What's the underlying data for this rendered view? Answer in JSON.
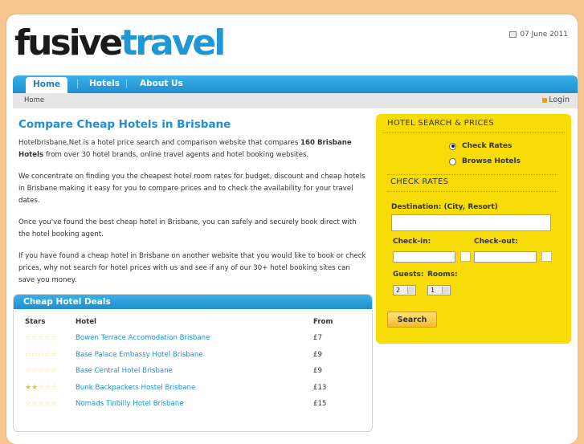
{
  "logo": {
    "part1": "fusive",
    "part2": "travel"
  },
  "date": "07 June 2011",
  "nav": {
    "home": "Home",
    "hotels": "Hotels",
    "about": "About Us"
  },
  "breadcrumb": {
    "home": "Home",
    "login": "Login"
  },
  "main": {
    "title": "Compare Cheap Hotels in Brisbane",
    "p1_a": "Hotelbrisbane.Net is a hotel price search and comparison website that compares ",
    "p1_bold": "160 Brisbane Hotels",
    "p1_b": " from over 30 hotel brands, online travel agents and hotel booking websites.",
    "p2": "We concentrate on finding you the cheapest hotel room rates for budget, discount and cheap hotels in Brisbane making it easy for you to compare prices and to check the availability for your travel dates.",
    "p3": "Once you've found the best cheap hotel in Brisbane, you can safely and securely book direct with the hotel booking agent.",
    "p4": "If you have found a cheap hotel in Brisbane on another website that you would like to book or check prices, why not search for hotel prices with us and see if any of our 30+ hotel booking sites can save you money."
  },
  "deals": {
    "title": "Cheap Hotel Deals",
    "headers": {
      "stars": "Stars",
      "hotel": "Hotel",
      "from": "From"
    },
    "rows": [
      {
        "stars": 0,
        "hotel": "Bowen Terrace Accomodation Brisbane",
        "from": "£7"
      },
      {
        "stars": 0,
        "hotel": "Base Palace Embassy Hotel Brisbane",
        "from": "£9"
      },
      {
        "stars": 0,
        "hotel": "Base Central Hotel Brisbane",
        "from": "£9"
      },
      {
        "stars": 2,
        "hotel": "Bunk Backpackers Hostel Brisbane",
        "from": "£13"
      },
      {
        "stars": 0,
        "hotel": "Nomads Tinbilly Hotel Brisbane",
        "from": "£15"
      }
    ]
  },
  "search": {
    "heading": "HOTEL SEARCH & PRICES",
    "opt_check": "Check Rates",
    "opt_browse": "Browse Hotels",
    "heading2": "CHECK RATES",
    "destination_label": "Destination: (City, Resort)",
    "checkin_label": "Check-in:",
    "checkout_label": "Check-out:",
    "guests_label": "Guests:",
    "rooms_label": "Rooms:",
    "guests_value": "2",
    "rooms_value": "1",
    "button": "Search"
  },
  "colors": {
    "accent": "#1f8fd0",
    "panel": "#f7dc07",
    "background": "#f9c58e"
  }
}
